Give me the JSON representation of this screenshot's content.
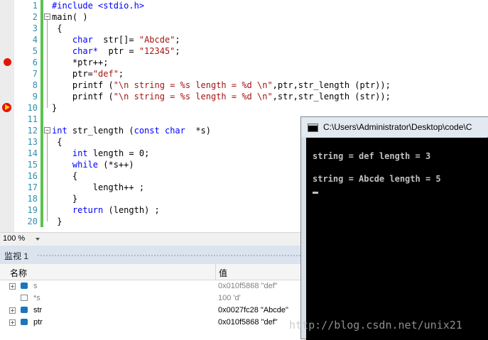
{
  "editor": {
    "line_numbers": [
      "1",
      "2",
      "3",
      "4",
      "5",
      "6",
      "7",
      "8",
      "9",
      "10",
      "11",
      "12",
      "13",
      "14",
      "15",
      "16",
      "17",
      "18",
      "19",
      "20"
    ],
    "lines": [
      [
        {
          "t": "#include <stdio.h>",
          "c": "pp"
        }
      ],
      [
        {
          "t": "main( )",
          "c": ""
        }
      ],
      [
        {
          "t": " {",
          "c": ""
        }
      ],
      [
        {
          "t": "    ",
          "c": ""
        },
        {
          "t": "char",
          "c": "kw"
        },
        {
          "t": "  str[]= ",
          "c": ""
        },
        {
          "t": "\"Abcde\"",
          "c": "str"
        },
        {
          "t": ";",
          "c": ""
        }
      ],
      [
        {
          "t": "    ",
          "c": ""
        },
        {
          "t": "char*",
          "c": "kw"
        },
        {
          "t": "  ptr = ",
          "c": ""
        },
        {
          "t": "\"12345\"",
          "c": "str"
        },
        {
          "t": ";",
          "c": ""
        }
      ],
      [
        {
          "t": "    *ptr++;",
          "c": ""
        }
      ],
      [
        {
          "t": "    ptr=",
          "c": ""
        },
        {
          "t": "\"def\"",
          "c": "str"
        },
        {
          "t": ";",
          "c": ""
        }
      ],
      [
        {
          "t": "    printf (",
          "c": ""
        },
        {
          "t": "\"\\n string = %s length = %d \\n\"",
          "c": "str"
        },
        {
          "t": ",ptr,str_length (ptr));",
          "c": ""
        }
      ],
      [
        {
          "t": "    printf (",
          "c": ""
        },
        {
          "t": "\"\\n string = %s length = %d \\n\"",
          "c": "str"
        },
        {
          "t": ",str,str_length (str));",
          "c": ""
        }
      ],
      [
        {
          "t": "}",
          "c": ""
        }
      ],
      [
        {
          "t": "",
          "c": ""
        }
      ],
      [
        {
          "t": "int",
          "c": "kw"
        },
        {
          "t": " str_length (",
          "c": ""
        },
        {
          "t": "const",
          "c": "kw"
        },
        {
          "t": " ",
          "c": ""
        },
        {
          "t": "char",
          "c": "kw"
        },
        {
          "t": "  *s)",
          "c": ""
        }
      ],
      [
        {
          "t": " {",
          "c": ""
        }
      ],
      [
        {
          "t": "    ",
          "c": ""
        },
        {
          "t": "int",
          "c": "kw"
        },
        {
          "t": " length = 0;",
          "c": ""
        }
      ],
      [
        {
          "t": "    ",
          "c": ""
        },
        {
          "t": "while",
          "c": "kw"
        },
        {
          "t": " (*s++)",
          "c": ""
        }
      ],
      [
        {
          "t": "    {",
          "c": ""
        }
      ],
      [
        {
          "t": "        length++ ;",
          "c": ""
        }
      ],
      [
        {
          "t": "    }",
          "c": ""
        }
      ],
      [
        {
          "t": "    ",
          "c": ""
        },
        {
          "t": "return",
          "c": "kw"
        },
        {
          "t": " (length) ;",
          "c": ""
        }
      ],
      [
        {
          "t": " }",
          "c": ""
        }
      ]
    ],
    "zoom": "100 %"
  },
  "watch": {
    "title": "监视 1",
    "col_name": "名称",
    "col_value": "值",
    "rows": [
      {
        "name": "s",
        "value": "0x010f5868 \"def\"",
        "expand": "+",
        "icon": "var",
        "stale": true
      },
      {
        "name": "*s",
        "value": "100 'd'",
        "expand": "",
        "icon": "field",
        "stale": true
      },
      {
        "name": "str",
        "value": "0x0027fc28 \"Abcde\"",
        "expand": "+",
        "icon": "var",
        "stale": false
      },
      {
        "name": "ptr",
        "value": "0x010f5868 \"def\"",
        "expand": "+",
        "icon": "var",
        "stale": false
      }
    ]
  },
  "console": {
    "title": "C:\\Users\\Administrator\\Desktop\\code\\C",
    "lines": [
      "string = def length = 3",
      "string = Abcde length = 5"
    ]
  },
  "watermark": "http://blog.csdn.net/unix21"
}
